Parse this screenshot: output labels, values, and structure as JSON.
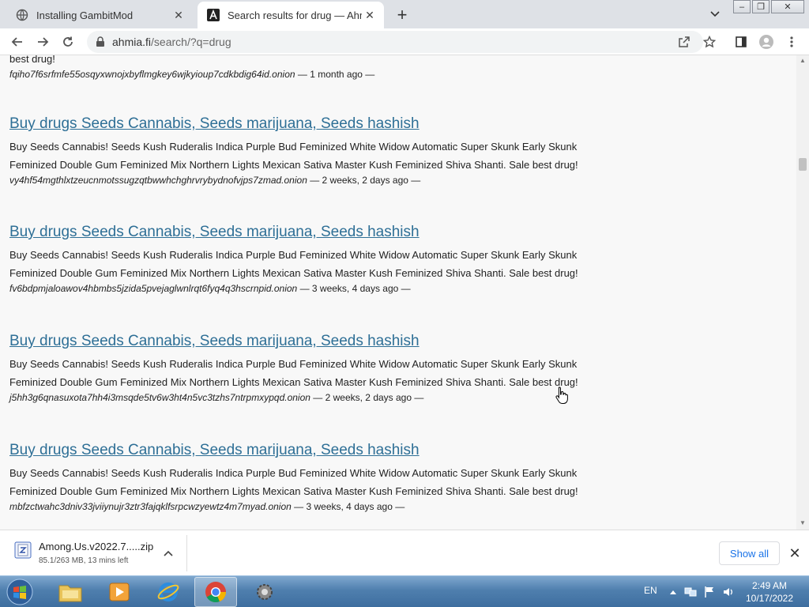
{
  "browser": {
    "tabs": [
      {
        "title": "Installing GambitMod",
        "close": "✕"
      },
      {
        "title": "Search results for drug — Ahmia",
        "close": "✕"
      }
    ],
    "new_tab": "+",
    "window_controls": {
      "minimize": "–",
      "maximize": "❐",
      "close": "✕"
    },
    "address": {
      "host": "ahmia.fi",
      "path": "/search/?q=drug"
    }
  },
  "results": [
    {
      "title": "",
      "description": "Skunk Feminized Double Gum Feminized Mix Northern Lights Mexican Sativa Master Kush Feminized Shiva Shanti. Sale best drug!",
      "onion": "fqiho7f6srfmfe55osqyxwnojxbyflmgkey6wjkyioup7cdkbdig64id.onion",
      "age": "— 1 month ago —"
    },
    {
      "title": "Buy drugs Seeds Cannabis, Seeds marijuana, Seeds hashish",
      "description": "Buy Seeds Cannabis! Seeds Kush Ruderalis Indica Purple Bud Feminized White Widow Automatic Super Skunk Early Skunk Feminized Double Gum Feminized Mix Northern Lights Mexican Sativa Master Kush Feminized Shiva Shanti. Sale best drug!",
      "onion": "vy4hf54mgthlxtzeucnmotssugzqtbwwhchghrvrybydnofvjps7zmad.onion",
      "age": "— 2 weeks, 2 days ago —"
    },
    {
      "title": "Buy drugs Seeds Cannabis, Seeds marijuana, Seeds hashish",
      "description": "Buy Seeds Cannabis! Seeds Kush Ruderalis Indica Purple Bud Feminized White Widow Automatic Super Skunk Early Skunk Feminized Double Gum Feminized Mix Northern Lights Mexican Sativa Master Kush Feminized Shiva Shanti. Sale best drug!",
      "onion": "fv6bdpmjaloawov4hbmbs5jzida5pvejaglwnlrqt6fyq4q3hscrnpid.onion",
      "age": "— 3 weeks, 4 days ago —"
    },
    {
      "title": "Buy drugs Seeds Cannabis, Seeds marijuana, Seeds hashish",
      "description": "Buy Seeds Cannabis! Seeds Kush Ruderalis Indica Purple Bud Feminized White Widow Automatic Super Skunk Early Skunk Feminized Double Gum Feminized Mix Northern Lights Mexican Sativa Master Kush Feminized Shiva Shanti. Sale best drug!",
      "onion": "j5hh3g6qnasuxota7hh4i3msqde5tv6w3ht4n5vc3tzhs7ntrpmxypqd.onion",
      "age": "— 2 weeks, 2 days ago —"
    },
    {
      "title": "Buy drugs Seeds Cannabis, Seeds marijuana, Seeds hashish",
      "description": "Buy Seeds Cannabis! Seeds Kush Ruderalis Indica Purple Bud Feminized White Widow Automatic Super Skunk Early Skunk Feminized Double Gum Feminized Mix Northern Lights Mexican Sativa Master Kush Feminized Shiva Shanti. Sale best drug!",
      "onion": "mbfzctwahc3dniv33jviiynujr3ztr3fajqklfsrpcwzyewtz4m7myad.onion",
      "age": "— 3 weeks, 4 days ago —"
    }
  ],
  "downloads": {
    "file_name": "Among.Us.v2022.7.....zip",
    "status": "85.1/263 MB, 13 mins left",
    "show_all": "Show all",
    "close": "✕"
  },
  "taskbar": {
    "language": "EN",
    "time": "2:49 AM",
    "date": "10/17/2022"
  }
}
